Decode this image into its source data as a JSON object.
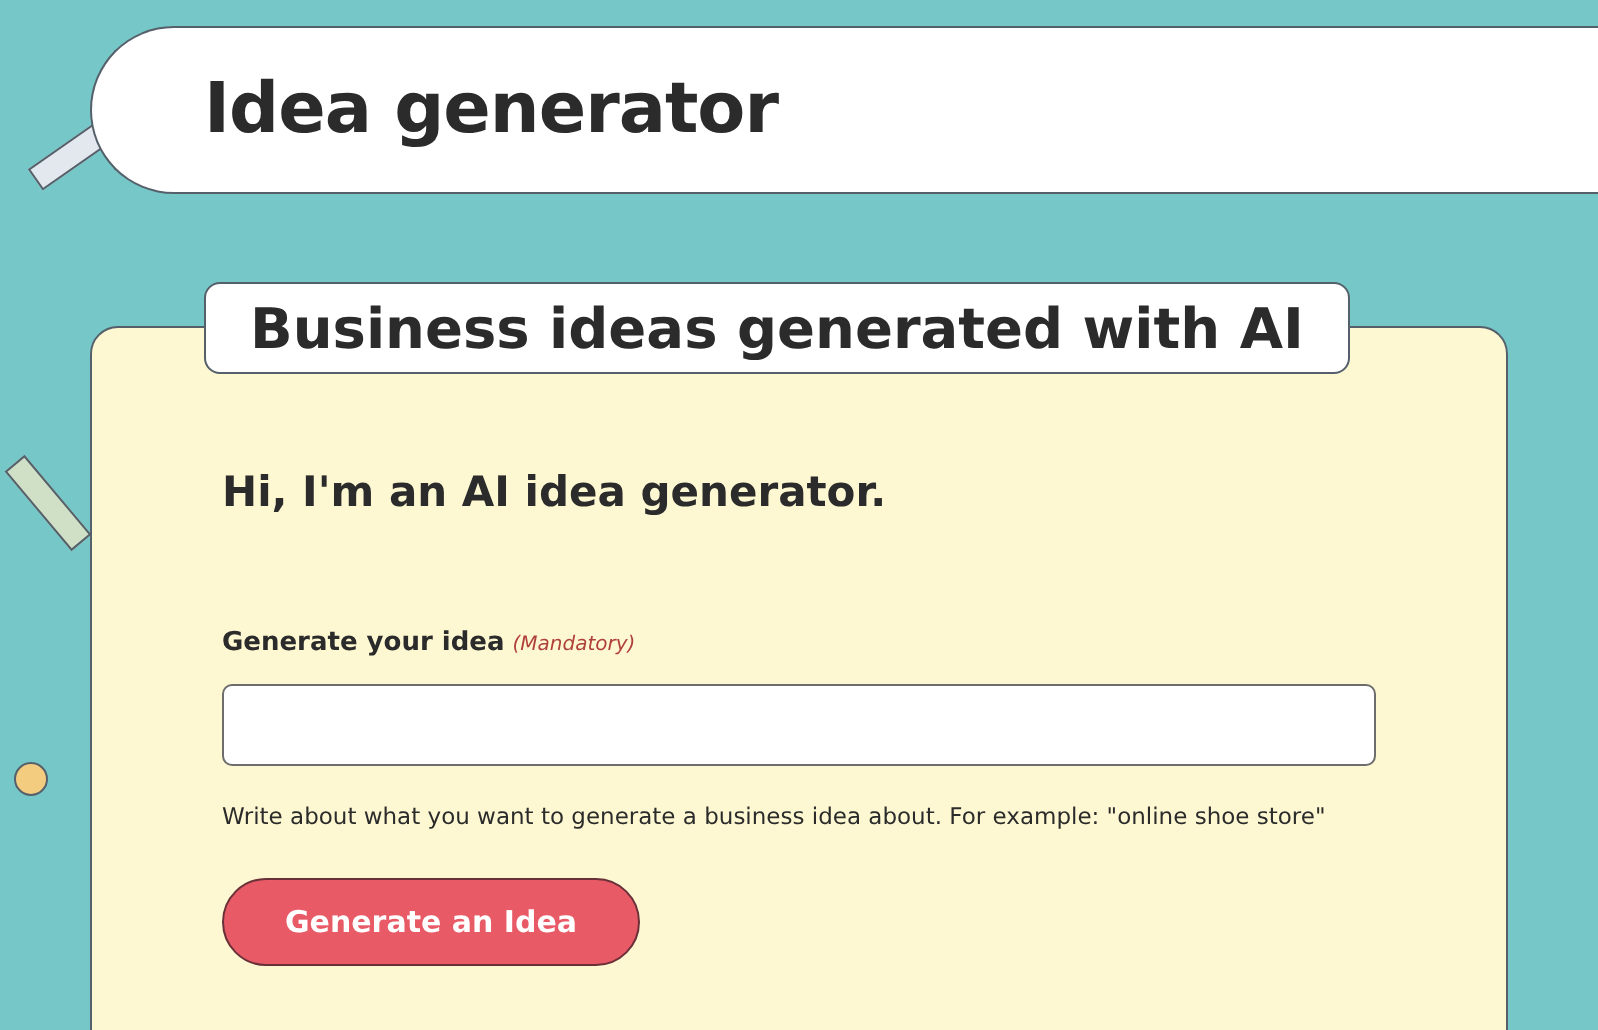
{
  "header": {
    "title": "Idea generator"
  },
  "card": {
    "tab_title": "Business ideas generated with AI",
    "greeting": "Hi, I'm an AI idea generator.",
    "field": {
      "label": "Generate your idea",
      "required_note": "(Mandatory)",
      "hint": "Write about what you want to generate a business idea about. For example: \"online shoe store\""
    },
    "button": "Generate an Idea"
  }
}
